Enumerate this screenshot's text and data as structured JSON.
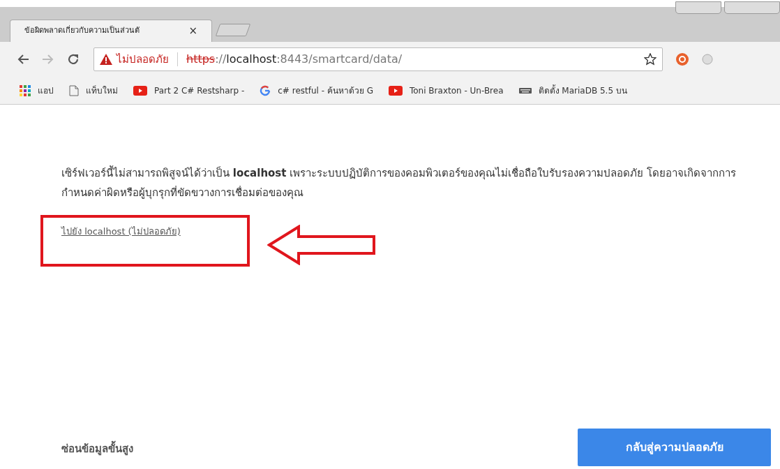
{
  "tab": {
    "title": "ข้อผิดพลาดเกี่ยวกับความเป็นส่วนตั",
    "close": "×"
  },
  "address_bar": {
    "security_label": "ไม่ปลอดภัย",
    "url_parts": [
      {
        "kind": "struck",
        "text": "https"
      },
      {
        "kind": "dim",
        "text": "://"
      },
      {
        "kind": "host",
        "text": "localhost"
      },
      {
        "kind": "dim",
        "text": ":8443/smartcard/data/"
      }
    ]
  },
  "bookmarks": [
    {
      "kind": "apps",
      "label": "แอป"
    },
    {
      "kind": "page",
      "label": "แท็บใหม่"
    },
    {
      "kind": "youtube",
      "label": "Part 2 C# Restsharp -"
    },
    {
      "kind": "google",
      "label": "c# restful - ค้นหาด้วย G"
    },
    {
      "kind": "youtube",
      "label": "Toni Braxton - Un-Brea"
    },
    {
      "kind": "keyboard",
      "label": "ติดตั้ง MariaDB 5.5 บน"
    }
  ],
  "message": "เซิร์ฟเวอร์นี้ไม่สามารถพิสูจน์ได้ว่าเป็น **localhost** เพราะระบบปฏิบัติการของคอมพิวเตอร์ของคุณไม่เชื่อถือใบรับรองความปลอดภัย โดยอาจเกิดจากการกำหนดค่าผิดหรือผู้บุกรุกที่ขัดขวางการเชื่อมต่อของคุณ",
  "proceed_link": "ไปยัง localhost (ไม่ปลอดภัย)",
  "hide_advanced": "ซ่อนข้อมูลขั้นสูง",
  "back_button": "กลับสู่ความปลอดภัย"
}
